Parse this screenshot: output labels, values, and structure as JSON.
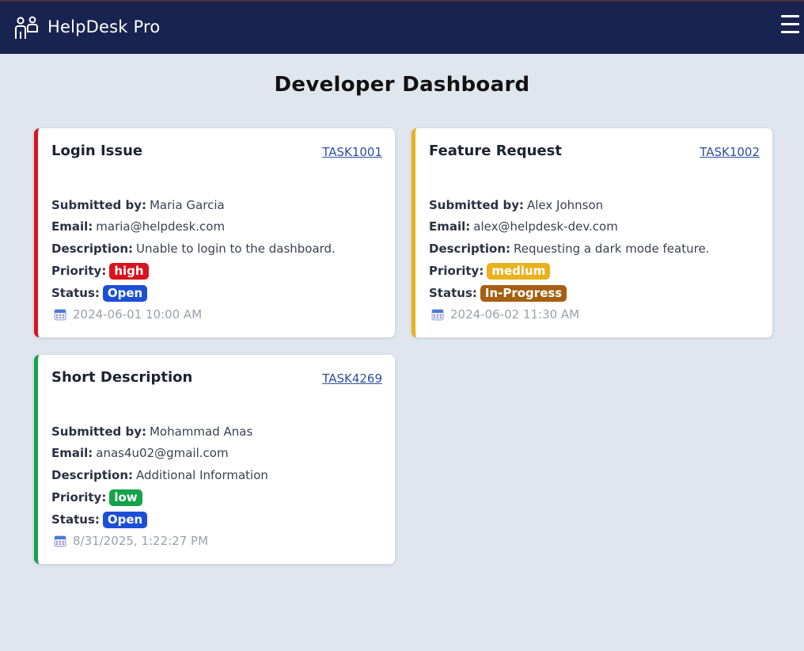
{
  "app": {
    "brand": "HelpDesk Pro",
    "brand_icon": "people-icon",
    "menu_icon": "hamburger-menu-icon"
  },
  "page": {
    "title": "Developer Dashboard"
  },
  "colors": {
    "navbar": "#19234f",
    "background": "#dfe6ee",
    "priority_high": "#d9141e",
    "priority_medium": "#e9b11c",
    "priority_low": "#15a34a",
    "status_open": "#1d4fd6",
    "status_in_progress": "#a55f0f"
  },
  "labels": {
    "submitted_by": "Submitted by:",
    "email": "Email:",
    "description": "Description:",
    "priority": "Priority:",
    "status": "Status:"
  },
  "tickets": [
    {
      "title": "Login Issue",
      "id": "TASK1001",
      "submitted_by": "Maria Garcia",
      "email": "maria@helpdesk.com",
      "description": "Unable to login to the dashboard.",
      "priority": "high",
      "status": "Open",
      "date": "2024-06-01 10:00 AM"
    },
    {
      "title": "Feature Request",
      "id": "TASK1002",
      "submitted_by": "Alex Johnson",
      "email": "alex@helpdesk-dev.com",
      "description": "Requesting a dark mode feature.",
      "priority": "medium",
      "status": "In-Progress",
      "date": "2024-06-02 11:30 AM"
    },
    {
      "title": "Short Description",
      "id": "TASK4269",
      "submitted_by": "Mohammad Anas",
      "email": "anas4u02@gmail.com",
      "description": "Additional Information",
      "priority": "low",
      "status": "Open",
      "date": "8/31/2025, 1:22:27 PM"
    }
  ]
}
